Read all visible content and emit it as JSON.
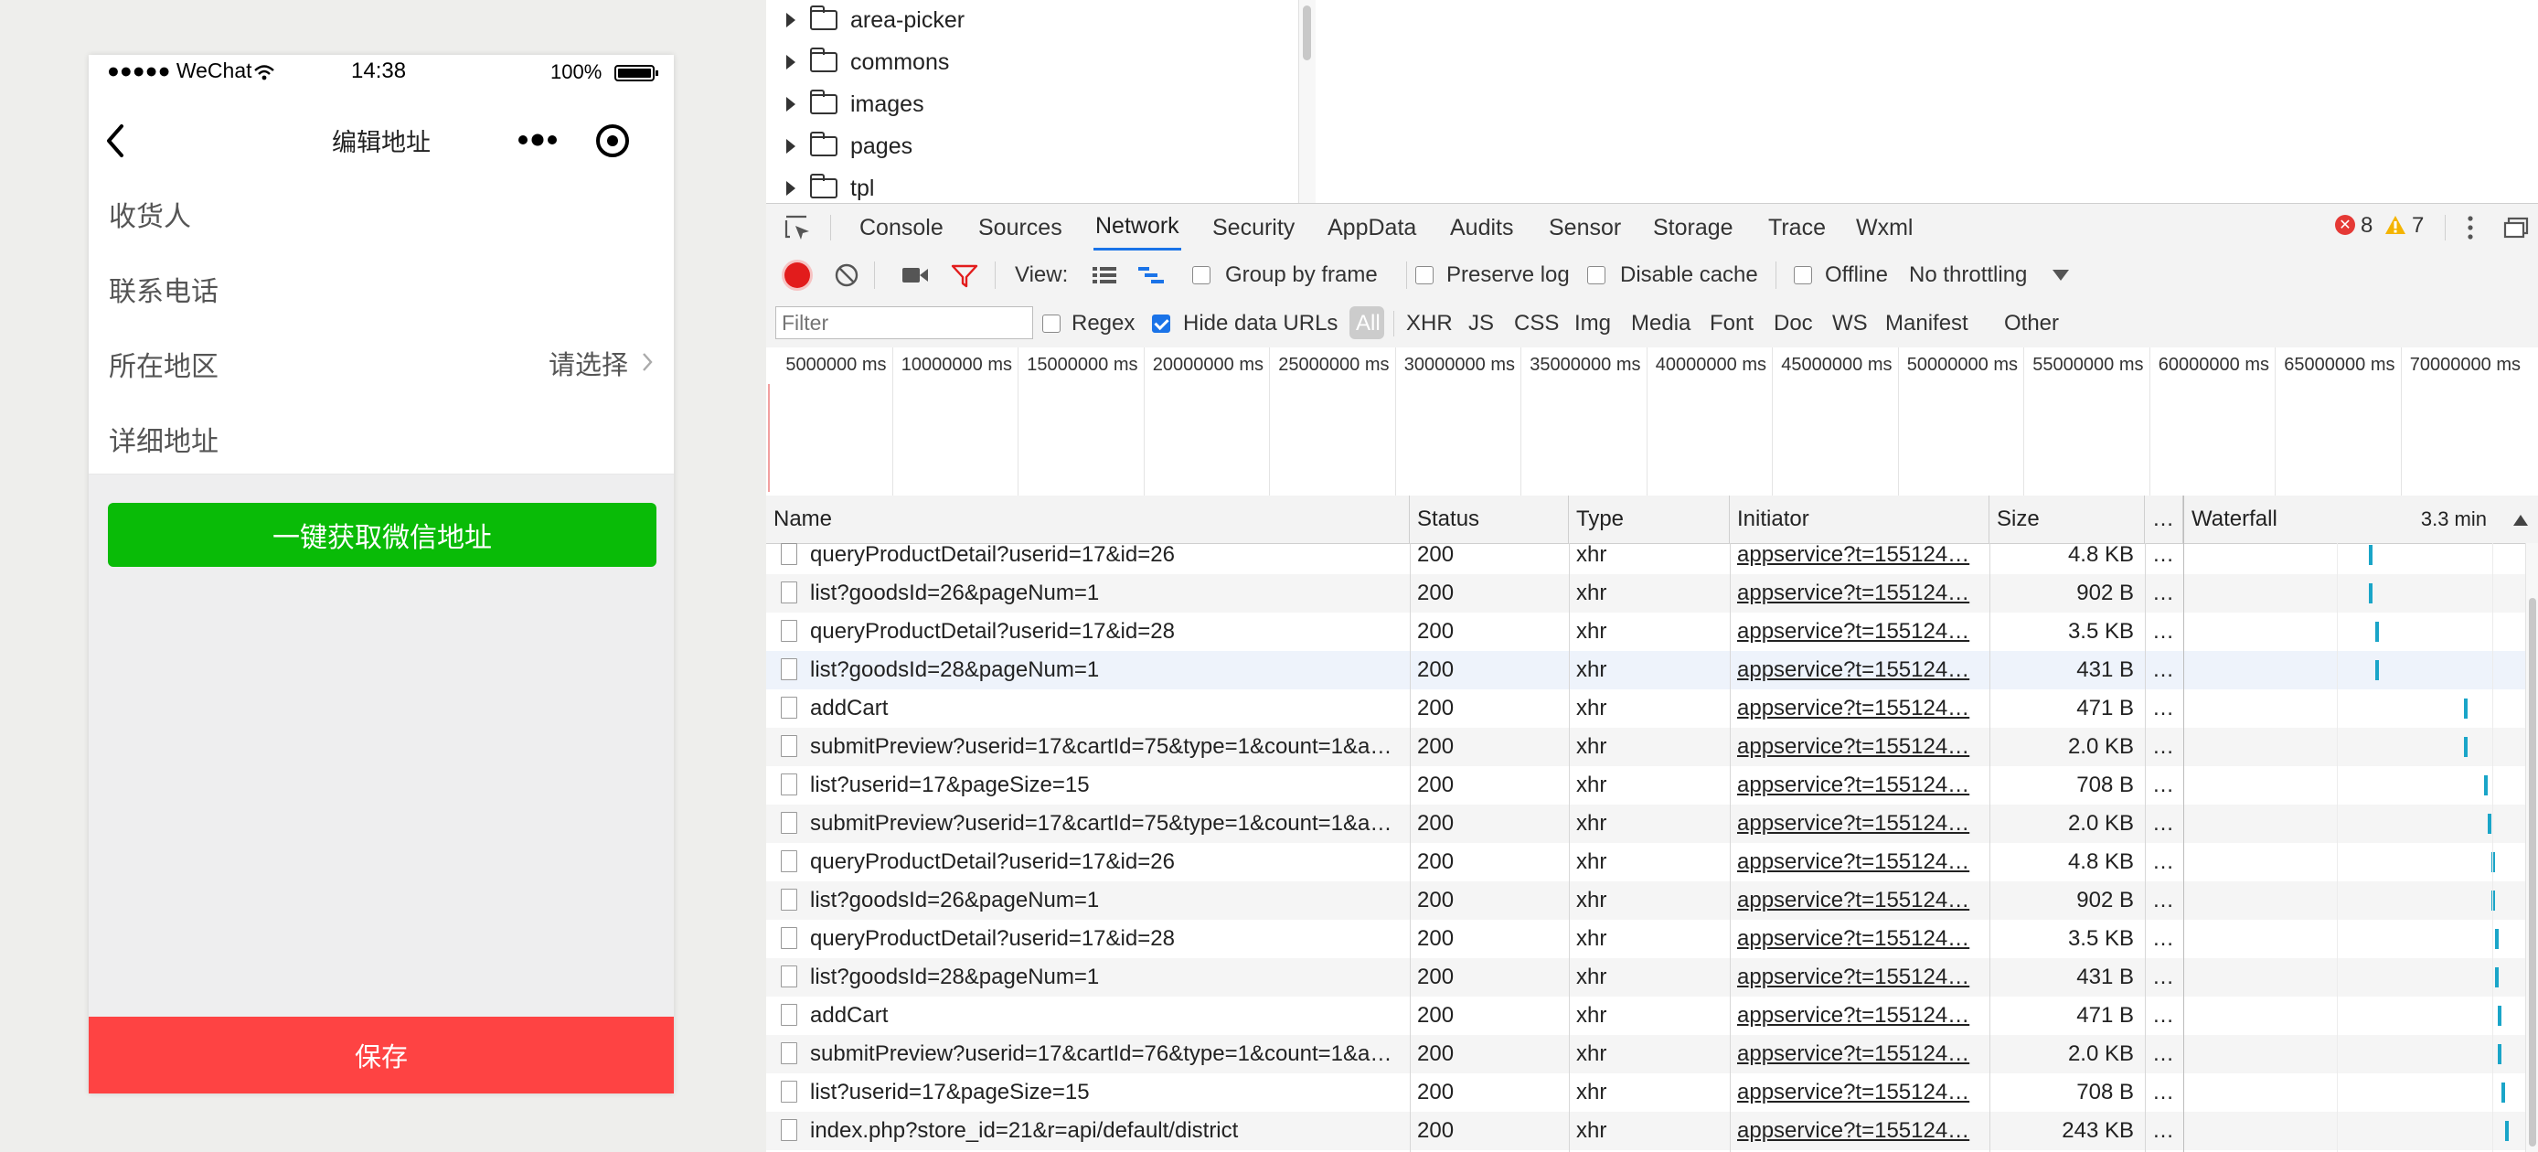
{
  "phone": {
    "status": {
      "carrier": "●●●●● WeChat",
      "time": "14:38",
      "battery": "100%"
    },
    "nav": {
      "title": "编辑地址"
    },
    "form": {
      "rows": [
        {
          "label": "收货人"
        },
        {
          "label": "联系电话"
        },
        {
          "label": "所在地区",
          "value": "请选择"
        },
        {
          "label": "详细地址"
        }
      ]
    },
    "wechat_button": "一键获取微信地址",
    "save_button": "保存",
    "colors": {
      "green": "#09bb07",
      "red": "#fe4343"
    }
  },
  "devtools": {
    "tree": [
      {
        "label": "area-picker"
      },
      {
        "label": "commons"
      },
      {
        "label": "images"
      },
      {
        "label": "pages"
      },
      {
        "label": "tpl"
      }
    ],
    "tabs": [
      "Console",
      "Sources",
      "Network",
      "Security",
      "AppData",
      "Audits",
      "Sensor",
      "Storage",
      "Trace",
      "Wxml"
    ],
    "active_tab": "Network",
    "errors": "8",
    "warnings": "7",
    "toolbar": {
      "view_label": "View:",
      "group_by_frame": "Group by frame",
      "preserve_log": "Preserve log",
      "disable_cache": "Disable cache",
      "offline": "Offline",
      "throttling": "No throttling"
    },
    "filter": {
      "placeholder": "Filter",
      "regex": "Regex",
      "hide_data_urls": "Hide data URLs",
      "types": [
        "All",
        "XHR",
        "JS",
        "CSS",
        "Img",
        "Media",
        "Font",
        "Doc",
        "WS",
        "Manifest",
        "Other"
      ]
    },
    "timeline_labels": [
      "5000000 ms",
      "10000000 ms",
      "15000000 ms",
      "20000000 ms",
      "25000000 ms",
      "30000000 ms",
      "35000000 ms",
      "40000000 ms",
      "45000000 ms",
      "50000000 ms",
      "55000000 ms",
      "60000000 ms",
      "65000000 ms",
      "70000000 ms"
    ],
    "columns": {
      "name": "Name",
      "status": "Status",
      "type": "Type",
      "initiator": "Initiator",
      "size": "Size",
      "more": "…",
      "waterfall": "Waterfall",
      "waterfall_time": "3.3 min"
    },
    "requests": [
      {
        "name": "queryProductDetail?userid=17&id=26",
        "status": "200",
        "type": "xhr",
        "initiator": "appservice?t=155124…",
        "size": "4.8 KB",
        "more": "…",
        "wf": 0.54
      },
      {
        "name": "list?goodsId=26&pageNum=1",
        "status": "200",
        "type": "xhr",
        "initiator": "appservice?t=155124…",
        "size": "902 B",
        "more": "…",
        "wf": 0.54
      },
      {
        "name": "queryProductDetail?userid=17&id=28",
        "status": "200",
        "type": "xhr",
        "initiator": "appservice?t=155124…",
        "size": "3.5 KB",
        "more": "…",
        "wf": 0.56
      },
      {
        "name": "list?goodsId=28&pageNum=1",
        "status": "200",
        "type": "xhr",
        "initiator": "appservice?t=155124…",
        "size": "431 B",
        "more": "…",
        "wf": 0.56
      },
      {
        "name": "addCart",
        "status": "200",
        "type": "xhr",
        "initiator": "appservice?t=155124…",
        "size": "471 B",
        "more": "…",
        "wf": 0.82
      },
      {
        "name": "submitPreview?userid=17&cartId=75&type=1&count=1&a…",
        "status": "200",
        "type": "xhr",
        "initiator": "appservice?t=155124…",
        "size": "2.0 KB",
        "more": "…",
        "wf": 0.82
      },
      {
        "name": "list?userid=17&pageSize=15",
        "status": "200",
        "type": "xhr",
        "initiator": "appservice?t=155124…",
        "size": "708 B",
        "more": "…",
        "wf": 0.88
      },
      {
        "name": "submitPreview?userid=17&cartId=75&type=1&count=1&a…",
        "status": "200",
        "type": "xhr",
        "initiator": "appservice?t=155124…",
        "size": "2.0 KB",
        "more": "…",
        "wf": 0.89
      },
      {
        "name": "queryProductDetail?userid=17&id=26",
        "status": "200",
        "type": "xhr",
        "initiator": "appservice?t=155124…",
        "size": "4.8 KB",
        "more": "…",
        "wf": 0.9
      },
      {
        "name": "list?goodsId=26&pageNum=1",
        "status": "200",
        "type": "xhr",
        "initiator": "appservice?t=155124…",
        "size": "902 B",
        "more": "…",
        "wf": 0.9
      },
      {
        "name": "queryProductDetail?userid=17&id=28",
        "status": "200",
        "type": "xhr",
        "initiator": "appservice?t=155124…",
        "size": "3.5 KB",
        "more": "…",
        "wf": 0.91
      },
      {
        "name": "list?goodsId=28&pageNum=1",
        "status": "200",
        "type": "xhr",
        "initiator": "appservice?t=155124…",
        "size": "431 B",
        "more": "…",
        "wf": 0.91
      },
      {
        "name": "addCart",
        "status": "200",
        "type": "xhr",
        "initiator": "appservice?t=155124…",
        "size": "471 B",
        "more": "…",
        "wf": 0.92
      },
      {
        "name": "submitPreview?userid=17&cartId=76&type=1&count=1&a…",
        "status": "200",
        "type": "xhr",
        "initiator": "appservice?t=155124…",
        "size": "2.0 KB",
        "more": "…",
        "wf": 0.92
      },
      {
        "name": "list?userid=17&pageSize=15",
        "status": "200",
        "type": "xhr",
        "initiator": "appservice?t=155124…",
        "size": "708 B",
        "more": "…",
        "wf": 0.93
      },
      {
        "name": "index.php?store_id=21&r=api/default/district",
        "status": "200",
        "type": "xhr",
        "initiator": "appservice?t=155124…",
        "size": "243 KB",
        "more": "…",
        "wf": 0.94
      }
    ],
    "selected_row": 3,
    "colors": {
      "accent": "#1a73e8",
      "record": "#e21c1c",
      "waterfall": "#1aa5c8",
      "error": "#e53935",
      "warning": "#f4b400"
    }
  }
}
